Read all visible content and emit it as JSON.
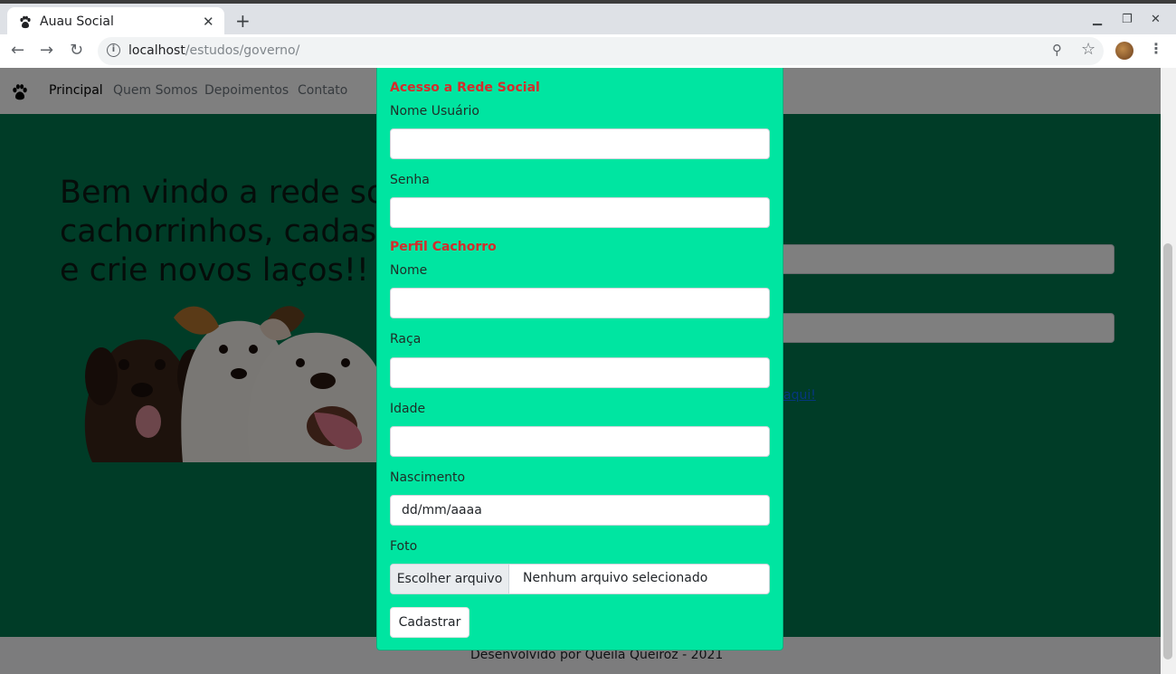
{
  "browser": {
    "tab_title": "Auau Social",
    "tab_close": "✕",
    "new_tab": "+",
    "url_host": "localhost",
    "url_path": "/estudos/governo/",
    "minimize": "▁",
    "restore": "❐",
    "close": "✕",
    "back": "←",
    "forward": "→",
    "reload": "↻",
    "zoom_icon": "⚲",
    "star_icon": "☆",
    "menu": "⋮"
  },
  "site": {
    "nav": [
      "Principal",
      "Quem Somos",
      "Depoimentos",
      "Contato"
    ],
    "hero_title_lines": [
      "Bem vindo a rede social de",
      "cachorrinhos, cadastre-se",
      "e crie novos laços!!"
    ],
    "link_text": "aqui!",
    "footer": "Desenvolvido por Queila Queiroz - 2021"
  },
  "modal": {
    "section_access": "Acesso a Rede Social",
    "label_username": "Nome Usuário",
    "label_password": "Senha",
    "section_profile": "Perfil Cachorro",
    "label_name": "Nome",
    "label_breed": "Raça",
    "label_age": "Idade",
    "label_birth": "Nascimento",
    "birth_placeholder": "dd/mm/aaaa",
    "label_photo": "Foto",
    "file_button": "Escolher arquivo",
    "file_status": "Nenhum arquivo selecionado",
    "submit": "Cadastrar"
  },
  "colors": {
    "modal_bg": "#00e5a1",
    "page_bg": "#00794f",
    "section_title": "#d62b2b"
  }
}
